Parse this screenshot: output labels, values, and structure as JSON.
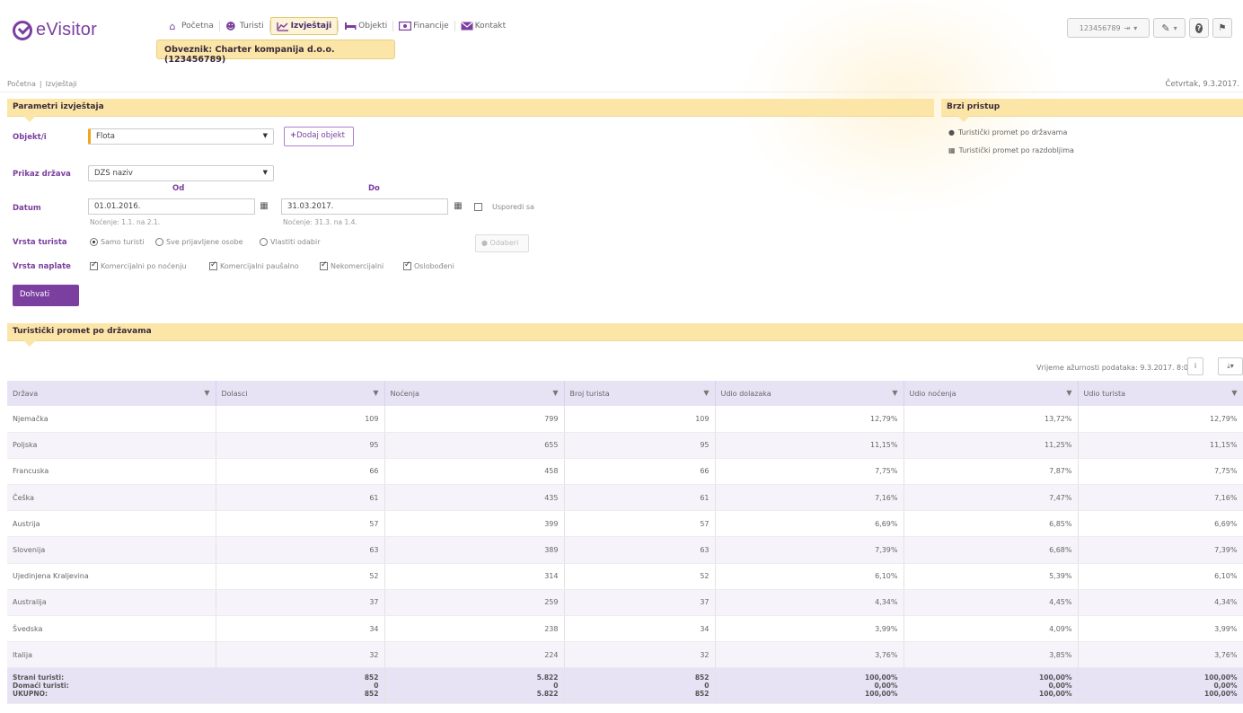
{
  "brand": {
    "name": "eVisitor"
  },
  "nav": {
    "items": [
      {
        "label": "Početna",
        "icon": "home-icon"
      },
      {
        "label": "Turisti",
        "icon": "users-icon"
      },
      {
        "label": "Izvještaji",
        "icon": "chart-icon",
        "active": true
      },
      {
        "label": "Objekti",
        "icon": "bed-icon"
      },
      {
        "label": "Financije",
        "icon": "money-icon"
      },
      {
        "label": "Kontakt",
        "icon": "envelope-icon"
      }
    ]
  },
  "obveznik": "Obveznik: Charter kompanija d.o.o. (123456789)",
  "toolbar": {
    "account": "123456789"
  },
  "breadcrumb": {
    "home": "Početna",
    "sep": "|",
    "current": "Izvještaji"
  },
  "date_display": "Četvrtak, 9.3.2017.",
  "params": {
    "title": "Parametri izvještaja",
    "objekt_label": "Objekt/i",
    "objekt_value": "Flota",
    "add_object": "Dodaj objekt",
    "prikaz_label": "Prikaz država",
    "prikaz_value": "DZS naziv",
    "od_label": "Od",
    "do_label": "Do",
    "datum_label": "Datum",
    "od_value": "01.01.2016.",
    "do_value": "31.03.2017.",
    "od_hint": "Noćenje: 1.1. na 2.1.",
    "do_hint": "Noćenje: 31.3. na 1.4.",
    "compare_label": "Usporedi sa",
    "vrsta_turista_label": "Vrsta turista",
    "vrsta_options": [
      "Samo turisti",
      "Sve prijavljene osobe",
      "Vlastiti odabir"
    ],
    "odaberi": "Odaberi",
    "vrsta_naplate_label": "Vrsta naplate",
    "naplate_options": [
      "Komercijalni po noćenju",
      "Komercijalni paušalno",
      "Nekomercijalni",
      "Oslobođeni"
    ],
    "fetch": "Dohvati"
  },
  "quick": {
    "title": "Brzi pristup",
    "links": [
      "Turistički promet po državama",
      "Turistički promet po razdobljima"
    ]
  },
  "report": {
    "title": "Turistički promet po državama",
    "freshness": "Vrijeme ažurnosti podataka: 9.3.2017. 8:05",
    "columns": [
      "Država",
      "Dolasci",
      "Noćenja",
      "Broj turista",
      "Udio dolazaka",
      "Udio noćenja",
      "Udio turista"
    ],
    "rows": [
      [
        "Njemačka",
        "109",
        "799",
        "109",
        "12,79%",
        "13,72%",
        "12,79%"
      ],
      [
        "Poljska",
        "95",
        "655",
        "95",
        "11,15%",
        "11,25%",
        "11,15%"
      ],
      [
        "Francuska",
        "66",
        "458",
        "66",
        "7,75%",
        "7,87%",
        "7,75%"
      ],
      [
        "Češka",
        "61",
        "435",
        "61",
        "7,16%",
        "7,47%",
        "7,16%"
      ],
      [
        "Austrija",
        "57",
        "399",
        "57",
        "6,69%",
        "6,85%",
        "6,69%"
      ],
      [
        "Slovenija",
        "63",
        "389",
        "63",
        "7,39%",
        "6,68%",
        "7,39%"
      ],
      [
        "Ujedinjena Kraljevina",
        "52",
        "314",
        "52",
        "6,10%",
        "5,39%",
        "6,10%"
      ],
      [
        "Australija",
        "37",
        "259",
        "37",
        "4,34%",
        "4,45%",
        "4,34%"
      ],
      [
        "Švedska",
        "34",
        "238",
        "34",
        "3,99%",
        "4,09%",
        "3,99%"
      ],
      [
        "Italija",
        "32",
        "224",
        "32",
        "3,76%",
        "3,85%",
        "3,76%"
      ]
    ],
    "footer": {
      "labels": [
        "Strani turisti:",
        "Domaći turisti:",
        "UKUPNO:"
      ],
      "cols": [
        [
          "852",
          "0",
          "852"
        ],
        [
          "5.822",
          "0",
          "5.822"
        ],
        [
          "852",
          "0",
          "852"
        ],
        [
          "100,00%",
          "0,00%",
          "100,00%"
        ],
        [
          "100,00%",
          "0,00%",
          "100,00%"
        ],
        [
          "100,00%",
          "0,00%",
          "100,00%"
        ]
      ]
    }
  },
  "colors": {
    "brand": "#7b3fa0",
    "highlight": "#fbe6a8",
    "table_header": "#e7e3f5",
    "alt_row": "#f7f3fa",
    "accent": "#f2a51c"
  }
}
